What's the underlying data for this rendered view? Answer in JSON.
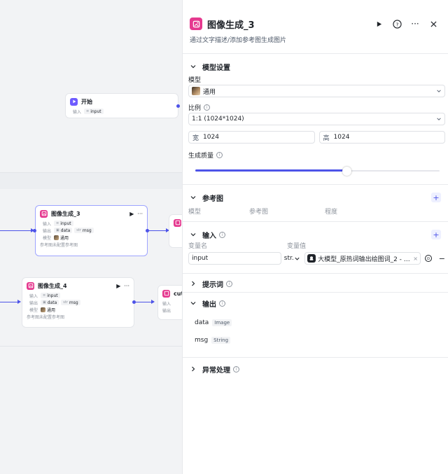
{
  "canvas": {
    "start_node": {
      "title": "开始",
      "input_key": "输入",
      "input_val": "input"
    },
    "node_selected": {
      "title": "图像生成_3",
      "rows": [
        {
          "key": "输入",
          "chips": [
            {
              "t": "",
              "v": "input"
            }
          ]
        },
        {
          "key": "输出",
          "chips": [
            {
              "t": "",
              "v": "data"
            },
            {
              "t": "",
              "v": "msg"
            }
          ]
        },
        {
          "key": "模型",
          "chips": [
            {
              "t": "",
              "v": "通用"
            }
          ]
        }
      ],
      "ref_key": "参考图",
      "ref_val": "未配置参考图"
    },
    "node_second": {
      "title": "图像生成_4",
      "rows": [
        {
          "key": "输入",
          "chips": [
            {
              "t": "",
              "v": "input"
            }
          ]
        },
        {
          "key": "输出",
          "chips": [
            {
              "t": "",
              "v": "data"
            },
            {
              "t": "",
              "v": "msg"
            }
          ]
        },
        {
          "key": "模型",
          "chips": [
            {
              "t": "",
              "v": "通用"
            }
          ]
        }
      ],
      "ref_key": "参考图",
      "ref_val": "未配置参考图"
    },
    "node_cut": {
      "title": "cuto",
      "row1_key": "输入",
      "row2_key": "输出"
    }
  },
  "panel": {
    "title": "图像生成_3",
    "description": "通过文字描述/添加参考图生成图片",
    "sections": {
      "model_settings": {
        "title": "模型设置",
        "model_label": "模型",
        "model_value": "通用",
        "ratio_label": "比例",
        "ratio_value": "1:1 (1024*1024)",
        "width_prefix": "宽",
        "width_value": "1024",
        "height_prefix": "高",
        "height_value": "1024",
        "quality_label": "生成质量",
        "quality_fraction": 0.62
      },
      "reference": {
        "title": "参考图",
        "columns": [
          "模型",
          "参考图",
          "程度"
        ]
      },
      "inputs": {
        "title": "输入",
        "col_name": "变量名",
        "col_value": "变量值",
        "rows": [
          {
            "name": "input",
            "type": "str.",
            "ref": "大模型_原热词输出绘图词_2 - ou···"
          }
        ]
      },
      "prompt": {
        "title": "提示词"
      },
      "outputs": {
        "title": "输出",
        "rows": [
          {
            "name": "data",
            "type": "Image"
          },
          {
            "name": "msg",
            "type": "String"
          }
        ]
      },
      "error": {
        "title": "异常处理"
      }
    }
  },
  "colors": {
    "accent": "#4d53e8",
    "icon_pink": "#e5398f",
    "start_icon": "#6e5bff"
  }
}
